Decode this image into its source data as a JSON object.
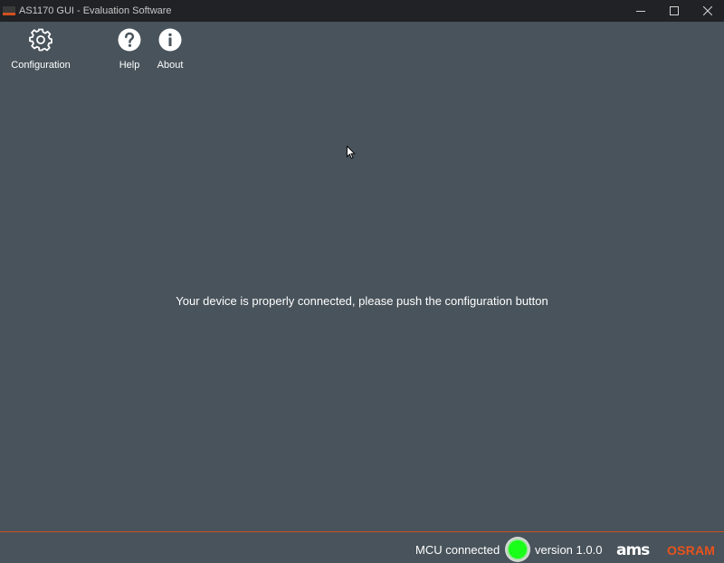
{
  "window": {
    "title": "AS1170 GUI - Evaluation Software",
    "controls": [
      "minimize-icon",
      "maximize-icon",
      "close-icon"
    ]
  },
  "toolbar": {
    "configuration_label": "Configuration",
    "help_label": "Help",
    "about_label": "About"
  },
  "main": {
    "message": "Your device is properly connected, please push the configuration button"
  },
  "status": {
    "mcu_label": "MCU connected",
    "mcu_state": "connected",
    "led_color": "#1aff1a",
    "version": "version 1.0.0"
  },
  "brand": {
    "ams_text": "ams",
    "osram_text": "OSRAM",
    "accent": "#d2501e"
  }
}
